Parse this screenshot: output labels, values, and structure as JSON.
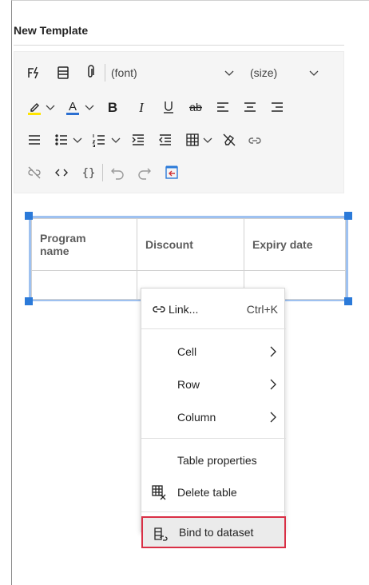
{
  "panel": {
    "title": "New Template"
  },
  "toolbar": {
    "font_label": "(font)",
    "size_label": "(size)",
    "icons": [
      "dynamic-content-icon",
      "paragraph-icon",
      "attach-icon",
      "highlight-icon",
      "font-color-icon",
      "bold-icon",
      "italic-icon",
      "underline-icon",
      "strikethrough-icon",
      "align-left-icon",
      "align-center-icon",
      "align-right-icon",
      "justify-icon",
      "bullet-list-icon",
      "numbered-list-icon",
      "increase-indent-icon",
      "decrease-indent-icon",
      "table-icon",
      "clear-format-icon",
      "link-icon",
      "unlink-icon",
      "code-icon",
      "braces-icon",
      "undo-icon",
      "redo-icon",
      "exit-icon"
    ],
    "highlight_color": "#ffe500",
    "font_color": "#2b6fd1"
  },
  "table": {
    "headers": [
      "Program\nname",
      "Discount",
      "Expiry date"
    ],
    "rows": [
      [
        "",
        "",
        ""
      ]
    ]
  },
  "context_menu": {
    "link": {
      "label": "Link...",
      "shortcut": "Ctrl+K"
    },
    "cell": "Cell",
    "row": "Row",
    "column": "Column",
    "table_properties": "Table properties",
    "delete_table": "Delete table",
    "bind_to_dataset": "Bind to dataset"
  },
  "colors": {
    "accent": "#2b7ad9",
    "selection_border": "#9ec1f0",
    "highlight_outline": "#d92f45"
  }
}
